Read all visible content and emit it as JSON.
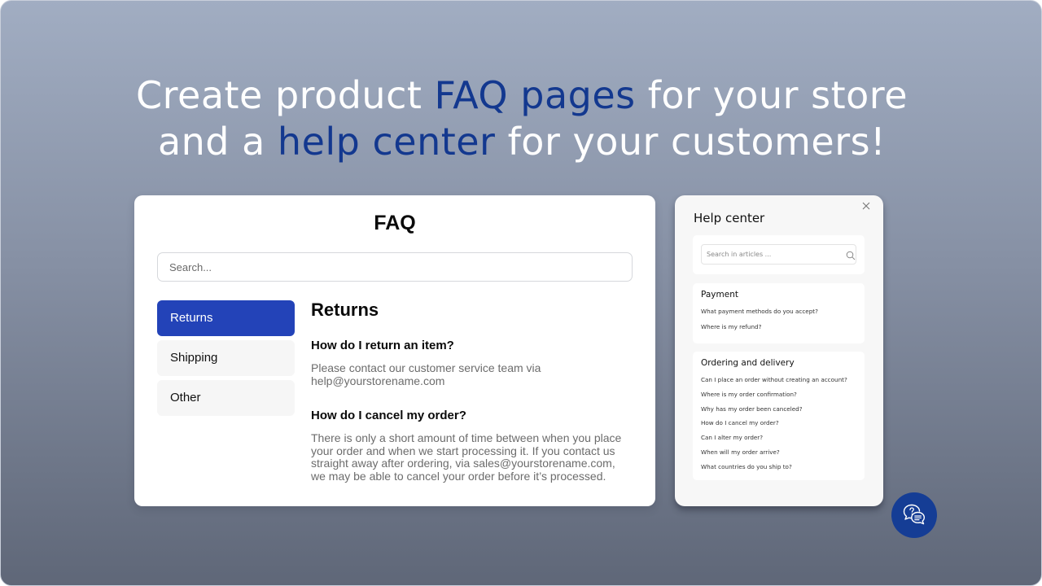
{
  "headline": {
    "line1_prefix": "Create product ",
    "line1_accent": "FAQ pages",
    "line1_suffix": " for your store",
    "line2_prefix": "and a ",
    "line2_accent": "help center",
    "line2_suffix": " for your customers!"
  },
  "colors": {
    "accent": "#13388f",
    "active_tab": "#2343b8",
    "fab": "#153d95"
  },
  "faq": {
    "title": "FAQ",
    "search_placeholder": "Search...",
    "nav": [
      {
        "label": "Returns",
        "active": true
      },
      {
        "label": "Shipping",
        "active": false
      },
      {
        "label": "Other",
        "active": false
      }
    ],
    "section_title": "Returns",
    "items": [
      {
        "question": "How do I return an item?",
        "answer": "Please contact our customer service team via help@yourstorename.com"
      },
      {
        "question": "How do I cancel my order?",
        "answer": "There is only a short amount of time between when you place your order and when we start processing it. If you contact us straight away after ordering, via sales@yourstorename.com, we may be able to cancel your order before it’s processed."
      }
    ]
  },
  "help_center": {
    "title": "Help center",
    "close_icon": "close-icon",
    "search_placeholder": "Search in articles ...",
    "search_icon": "search-icon",
    "sections": [
      {
        "title": "Payment",
        "links": [
          "What payment methods do you accept?",
          "Where is my refund?"
        ]
      },
      {
        "title": "Ordering and delivery",
        "links": [
          "Can I place an order without creating an account?",
          "Where is my order confirmation?",
          "Why has my order been canceled?",
          "How do I cancel my order?",
          "Can I alter my order?",
          "When will my order arrive?",
          "What countries do you ship to?"
        ]
      }
    ]
  },
  "fab": {
    "icon": "chat-question-icon"
  }
}
